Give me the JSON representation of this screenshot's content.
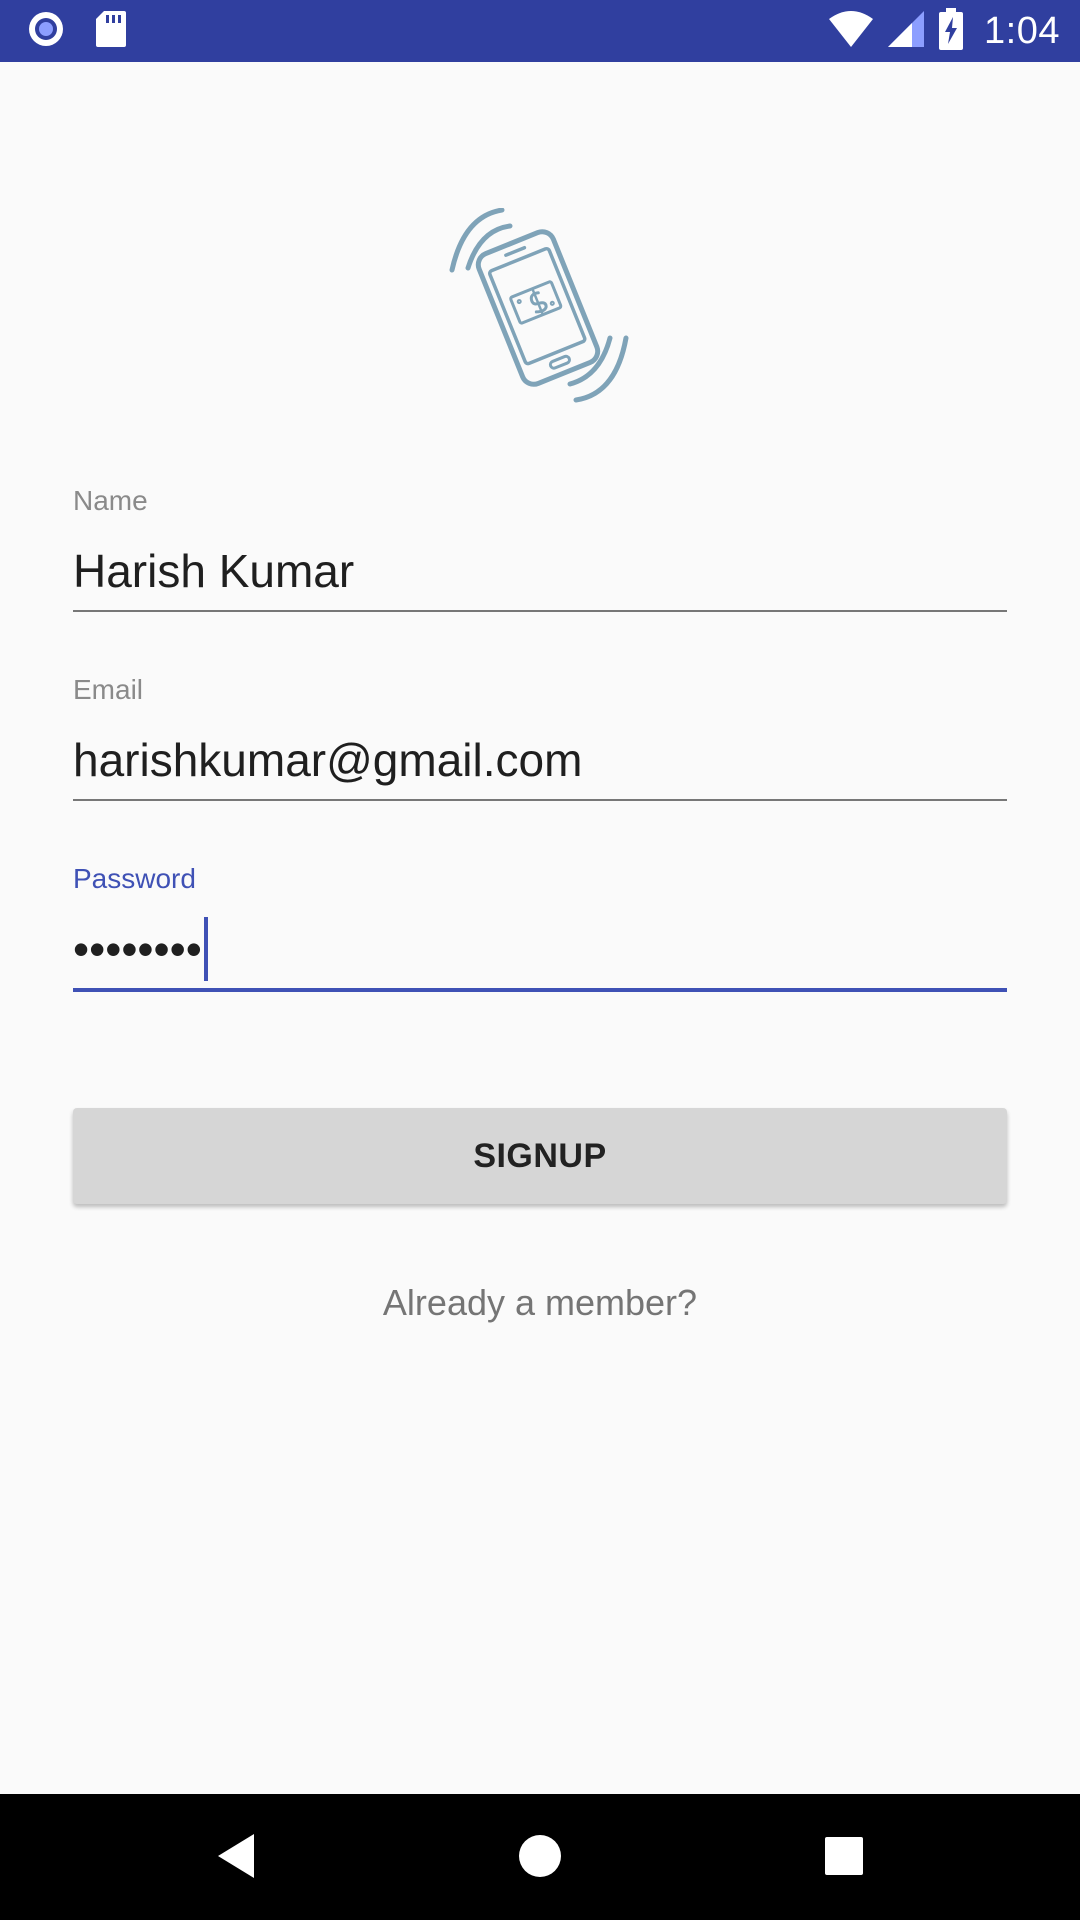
{
  "status_bar": {
    "time": "1:04",
    "icons": [
      "record-icon",
      "sd-card-icon",
      "wifi-icon",
      "signal-icon",
      "battery-charging-icon"
    ]
  },
  "form": {
    "name": {
      "label": "Name",
      "value": "Harish Kumar"
    },
    "email": {
      "label": "Email",
      "value": "harishkumar@gmail.com"
    },
    "password": {
      "label": "Password",
      "value": "••••••••"
    },
    "signup_label": "SIGNUP",
    "member_link": "Already a member?"
  },
  "colors": {
    "status_bar": "#303f9f",
    "accent": "#3f51b5",
    "logo": "#7fa3b8",
    "button": "#d6d6d6"
  },
  "nav_bar": {
    "icons": [
      "back-icon",
      "home-icon",
      "recents-icon"
    ]
  }
}
